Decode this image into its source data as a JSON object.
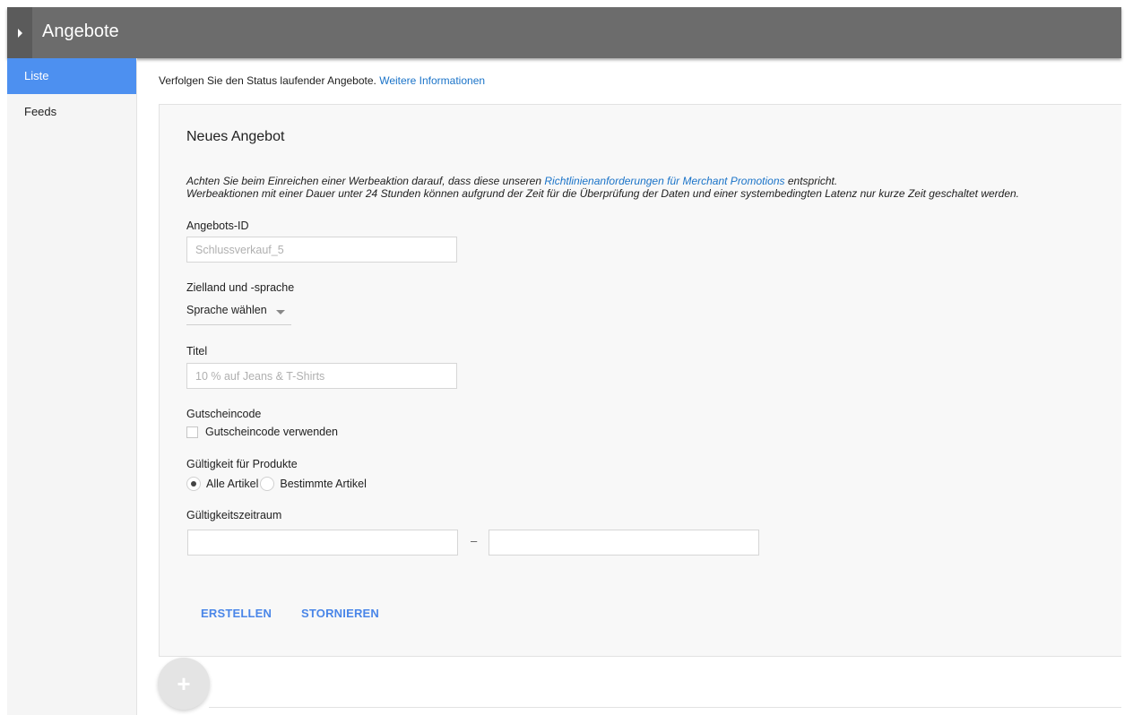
{
  "header": {
    "title": "Angebote"
  },
  "sidebar": {
    "items": [
      {
        "label": "Liste"
      },
      {
        "label": "Feeds"
      }
    ]
  },
  "intro": {
    "text": "Verfolgen Sie den Status laufender Angebote.",
    "link": "Weitere Informationen"
  },
  "form": {
    "title": "Neues Angebot",
    "notice": {
      "line1_before": "Achten Sie beim Einreichen einer Werbeaktion darauf, dass diese unseren ",
      "line1_link": "Richtlinienanforderungen für Merchant Promotions",
      "line1_after": " entspricht.",
      "line2": "Werbeaktionen mit einer Dauer unter 24 Stunden können aufgrund der Zeit für die Überprüfung der Daten und einer systembedingten Latenz nur kurze Zeit geschaltet werden."
    },
    "offer_id": {
      "label": "Angebots-ID",
      "placeholder": "Schlussverkauf_5",
      "value": ""
    },
    "target": {
      "label": "Zielland und -sprache",
      "selected": "Sprache wählen"
    },
    "title_field": {
      "label": "Titel",
      "placeholder": "10 % auf Jeans & T-Shirts",
      "value": ""
    },
    "coupon": {
      "label": "Gutscheincode",
      "checkbox_label": "Gutscheincode verwenden",
      "checked": false
    },
    "validity_products": {
      "label": "Gültigkeit für Produkte",
      "options": [
        {
          "label": "Alle Artikel",
          "checked": true
        },
        {
          "label": "Bestimmte Artikel",
          "checked": false
        }
      ]
    },
    "validity_period": {
      "label": "Gültigkeitszeitraum",
      "separator": "–",
      "start": "",
      "end": ""
    },
    "buttons": {
      "create": "ERSTELLEN",
      "cancel": "STORNIEREN"
    }
  },
  "fab": {
    "icon": "plus-icon",
    "glyph": "+"
  },
  "colors": {
    "header_bg": "#6c6c6c",
    "active_nav": "#4d90f0",
    "link": "#1a73c8",
    "button_text": "#4a86e8"
  }
}
